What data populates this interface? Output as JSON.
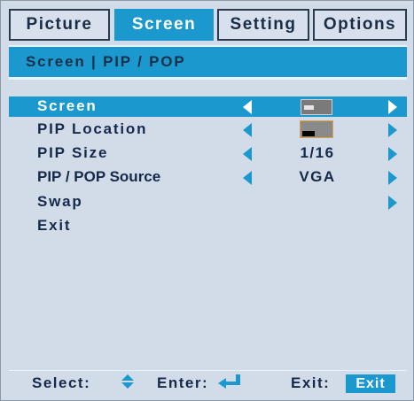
{
  "tabs": [
    {
      "label": "Picture",
      "active": false
    },
    {
      "label": "Screen",
      "active": true
    },
    {
      "label": "Setting",
      "active": false
    },
    {
      "label": "Options",
      "active": false
    }
  ],
  "breadcrumb": "Screen | PIP / POP",
  "menu": {
    "items": [
      {
        "label": "Screen",
        "selected": true,
        "value_icon": "screen-thumbnail-icon"
      },
      {
        "label": "PIP Location",
        "selected": false,
        "value_icon": "pip-location-thumbnail-icon"
      },
      {
        "label": "PIP Size",
        "selected": false,
        "value": "1/16"
      },
      {
        "label": "PIP / POP Source",
        "selected": false,
        "value": "VGA"
      },
      {
        "label": "Swap",
        "selected": false
      },
      {
        "label": "Exit",
        "selected": false
      }
    ]
  },
  "status_bar": {
    "select_label": "Select:",
    "select_icon": "up-down-arrows-icon",
    "enter_label": "Enter:",
    "enter_icon": "enter-return-icon",
    "exit_label": "Exit:",
    "exit_badge": "Exit"
  },
  "colors": {
    "accent": "#1b99cf",
    "background": "#d2dce8",
    "text": "#15294a"
  }
}
